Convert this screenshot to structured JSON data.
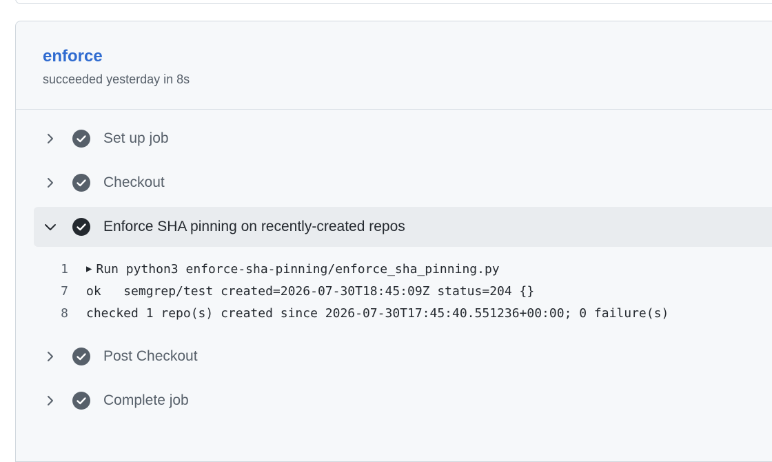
{
  "job": {
    "title": "enforce",
    "subtitle": "succeeded yesterday in 8s"
  },
  "steps": [
    {
      "label": "Set up job",
      "expanded": false,
      "status": "success"
    },
    {
      "label": "Checkout",
      "expanded": false,
      "status": "success"
    },
    {
      "label": "Enforce SHA pinning on recently-created repos",
      "expanded": true,
      "status": "success"
    },
    {
      "label": "Post Checkout",
      "expanded": false,
      "status": "success"
    },
    {
      "label": "Complete job",
      "expanded": false,
      "status": "success"
    }
  ],
  "log": [
    {
      "line": "1",
      "text": "Run python3 enforce-sha-pinning/enforce_sha_pinning.py",
      "collapsible": true
    },
    {
      "line": "7",
      "text": "ok   semgrep/test created=2026-07-30T18:45:09Z status=204 {}"
    },
    {
      "line": "8",
      "text": "checked 1 repo(s) created since 2026-07-30T17:45:40.551236+00:00; 0 failure(s)"
    }
  ],
  "colors": {
    "link": "#2f6bd0",
    "check_completed": "#57606a",
    "check_active": "#24292f",
    "expanded_row_bg": "#e9ecef"
  },
  "icons": {
    "collapsed": "chevron-right-icon",
    "expanded": "chevron-down-icon",
    "status": "check-circle-icon",
    "disclosure": "triangle-right-icon"
  }
}
